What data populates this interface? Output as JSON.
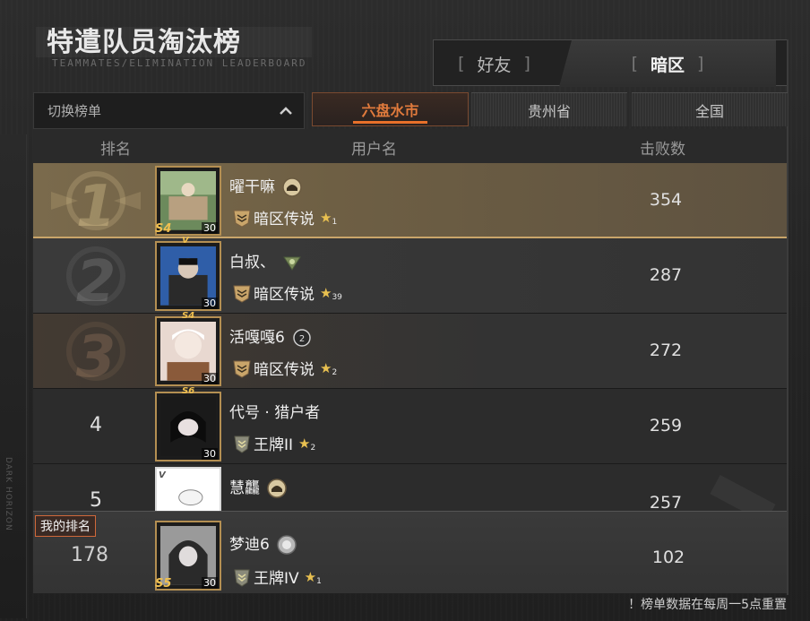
{
  "title": "特遣队员淘汰榜",
  "subtitle": "TEAMMATES/ELIMINATION LEADERBOARD",
  "tabs": {
    "friends": "好友",
    "dark_zone": "暗区"
  },
  "dropdown": {
    "label": "切换榜单",
    "icon": "chevron-up-icon"
  },
  "regions": [
    {
      "label": "六盘水市",
      "active": true
    },
    {
      "label": "贵州省",
      "active": false
    },
    {
      "label": "全国",
      "active": false
    }
  ],
  "columns": {
    "rank": "排名",
    "username": "用户名",
    "kills": "击败数"
  },
  "rows": [
    {
      "rank": "1",
      "name": "曜干嘛",
      "tier": "暗区传说",
      "stars": "1",
      "kills": "354",
      "level": "30",
      "season": "S4"
    },
    {
      "rank": "2",
      "name": "白叔、",
      "tier": "暗区传说",
      "stars": "39",
      "kills": "287",
      "level": "30",
      "season": ""
    },
    {
      "rank": "3",
      "name": "活嘎嘎6",
      "tier": "暗区传说",
      "stars": "2",
      "kills": "272",
      "level": "30",
      "season": "S4"
    },
    {
      "rank": "4",
      "name": "代号 · 猎户者",
      "tier": "王牌II",
      "stars": "2",
      "kills": "259",
      "level": "30",
      "season": "S6"
    },
    {
      "rank": "5",
      "name": "慧龘",
      "tier": "",
      "stars": "",
      "kills": "257",
      "level": "",
      "season": ""
    }
  ],
  "my_rank": {
    "label": "我的排名",
    "rank": "178",
    "name": "梦迪6",
    "tier": "王牌IV",
    "stars": "1",
    "kills": "102",
    "level": "30",
    "season": "S5"
  },
  "footer_note": "！榜单数据在每周一5点重置",
  "colors": {
    "accent": "#e8702a",
    "gold": "#c9a56a",
    "star": "#e8c050"
  }
}
